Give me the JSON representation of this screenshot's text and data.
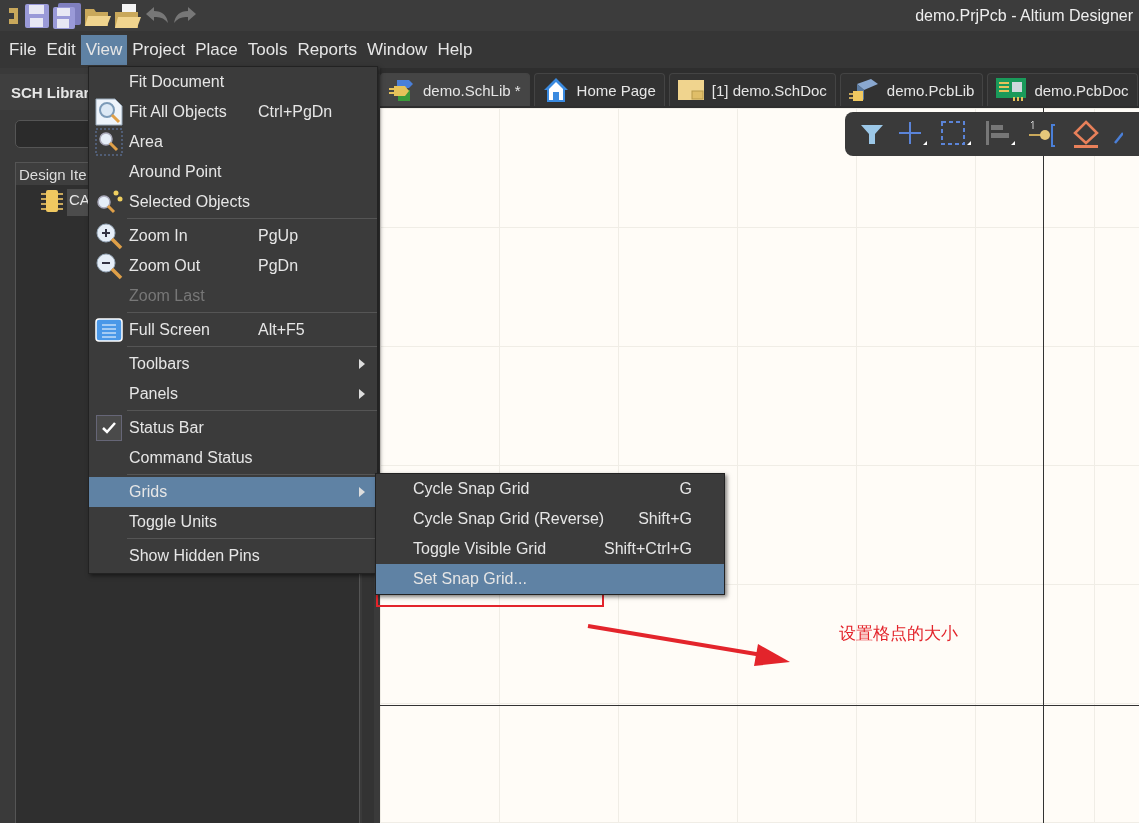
{
  "window": {
    "title": "demo.PrjPcb - Altium Designer"
  },
  "menu_bar": [
    {
      "label": "File",
      "selected": false
    },
    {
      "label": "Edit",
      "selected": false
    },
    {
      "label": "View",
      "selected": true
    },
    {
      "label": "Project",
      "selected": false
    },
    {
      "label": "Place",
      "selected": false
    },
    {
      "label": "Tools",
      "selected": false
    },
    {
      "label": "Reports",
      "selected": false
    },
    {
      "label": "Window",
      "selected": false
    },
    {
      "label": "Help",
      "selected": false
    }
  ],
  "panel": {
    "title": "SCH Librar",
    "tree_header": "Design Ite",
    "tree_items": [
      {
        "label": "CA",
        "selected": true
      }
    ]
  },
  "tabs": [
    {
      "label": "demo.SchLib *",
      "selected": true
    },
    {
      "label": "Home Page",
      "selected": false
    },
    {
      "label": "[1] demo.SchDoc",
      "selected": false
    },
    {
      "label": "demo.PcbLib",
      "selected": false
    },
    {
      "label": "demo.PcbDoc",
      "selected": false
    }
  ],
  "view_menu": [
    {
      "label": "Fit Document",
      "separator_before": false,
      "disabled": false,
      "checked": false,
      "selected": false,
      "submenu": false
    },
    {
      "label": "Fit All Objects",
      "shortcut": "Ctrl+PgDn",
      "separator_before": false,
      "disabled": false,
      "checked": false,
      "selected": false,
      "submenu": false
    },
    {
      "label": "Area",
      "separator_before": false,
      "disabled": false,
      "checked": false,
      "selected": false,
      "submenu": false
    },
    {
      "label": "Around Point",
      "separator_before": false,
      "disabled": false,
      "checked": false,
      "selected": false,
      "submenu": false
    },
    {
      "label": "Selected Objects",
      "separator_before": false,
      "disabled": false,
      "checked": false,
      "selected": false,
      "submenu": false
    },
    {
      "label": "Zoom In",
      "shortcut": "PgUp",
      "separator_before": true,
      "disabled": false,
      "checked": false,
      "selected": false,
      "submenu": false
    },
    {
      "label": "Zoom Out",
      "shortcut": "PgDn",
      "separator_before": false,
      "disabled": false,
      "checked": false,
      "selected": false,
      "submenu": false
    },
    {
      "label": "Zoom Last",
      "separator_before": false,
      "disabled": true,
      "checked": false,
      "selected": false,
      "submenu": false
    },
    {
      "label": "Full Screen",
      "shortcut": "Alt+F5",
      "separator_before": true,
      "disabled": false,
      "checked": false,
      "selected": false,
      "submenu": false
    },
    {
      "label": "Toolbars",
      "separator_before": true,
      "disabled": false,
      "checked": false,
      "selected": false,
      "submenu": true
    },
    {
      "label": "Panels",
      "separator_before": false,
      "disabled": false,
      "checked": false,
      "selected": false,
      "submenu": true
    },
    {
      "label": "Status Bar",
      "separator_before": true,
      "disabled": false,
      "checked": true,
      "selected": false,
      "submenu": false
    },
    {
      "label": "Command Status",
      "separator_before": false,
      "disabled": false,
      "checked": false,
      "selected": false,
      "submenu": false
    },
    {
      "label": "Grids",
      "separator_before": true,
      "disabled": false,
      "checked": false,
      "selected": true,
      "submenu": true
    },
    {
      "label": "Toggle Units",
      "separator_before": false,
      "disabled": false,
      "checked": false,
      "selected": false,
      "submenu": false
    },
    {
      "label": "Show Hidden Pins",
      "separator_before": true,
      "disabled": false,
      "checked": false,
      "selected": false,
      "submenu": false
    }
  ],
  "grids_submenu": [
    {
      "label": "Cycle Snap Grid",
      "shortcut": "G",
      "selected": false
    },
    {
      "label": "Cycle Snap Grid (Reverse)",
      "shortcut": "Shift+G",
      "selected": false
    },
    {
      "label": "Toggle Visible Grid",
      "shortcut": "Shift+Ctrl+G",
      "selected": false
    },
    {
      "label": "Set Snap Grid...",
      "selected": true
    }
  ],
  "annotation": {
    "text": "设置格点的大小"
  }
}
